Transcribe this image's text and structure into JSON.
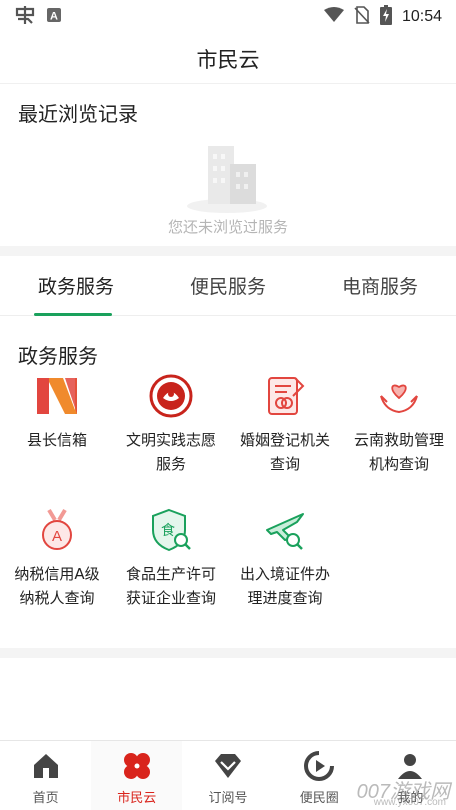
{
  "status_bar": {
    "time": "10:54",
    "icons": [
      "app-notification-icon",
      "a-letter-icon",
      "wifi-icon",
      "no-sim-icon",
      "battery-charging-icon"
    ]
  },
  "header": {
    "title": "市民云"
  },
  "recent": {
    "title": "最近浏览记录",
    "empty_text": "您还未浏览过服务",
    "illustration": "empty-buildings-illustration"
  },
  "tabs": [
    {
      "label": "政务服务",
      "active": true
    },
    {
      "label": "便民服务",
      "active": false
    },
    {
      "label": "电商服务",
      "active": false
    }
  ],
  "gov_services": {
    "title": "政务服务",
    "items": [
      {
        "label": "县长信箱",
        "icon": "mailbox-n-logo-icon"
      },
      {
        "label": "文明实践志愿服务",
        "icon": "volunteer-seal-icon"
      },
      {
        "label": "婚姻登记机关查询",
        "icon": "marriage-document-icon"
      },
      {
        "label": "云南救助管理机构查询",
        "icon": "helping-hands-heart-icon"
      },
      {
        "label": "纳税信用A级纳税人查询",
        "icon": "medal-a-icon"
      },
      {
        "label": "食品生产许可获证企业查询",
        "icon": "food-shield-search-icon"
      },
      {
        "label": "出入境证件办理进度查询",
        "icon": "airplane-search-icon"
      }
    ]
  },
  "bottom_nav": [
    {
      "label": "首页",
      "icon": "home-icon",
      "active": false
    },
    {
      "label": "市民云",
      "icon": "clover-icon",
      "active": true
    },
    {
      "label": "订阅号",
      "icon": "diamond-icon",
      "active": false
    },
    {
      "label": "便民圈",
      "icon": "circle-play-icon",
      "active": false
    },
    {
      "label": "我的",
      "icon": "person-icon",
      "active": false
    }
  ],
  "watermark": {
    "text": "007游戏网",
    "sub": "www.yx007.com"
  },
  "colors": {
    "accent_green": "#1aa15c",
    "active_red": "#d9241c",
    "icon_red": "#e2463f"
  }
}
